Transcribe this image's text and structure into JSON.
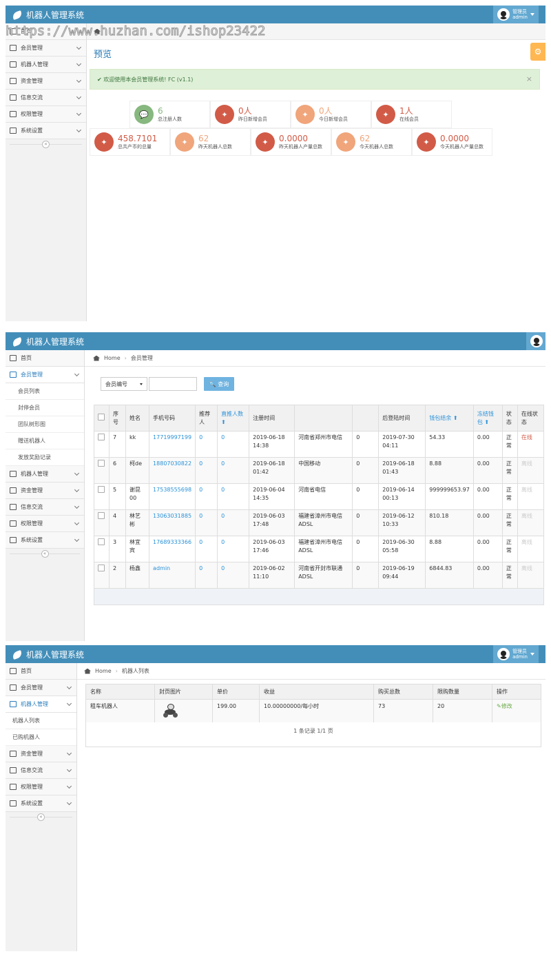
{
  "app_title": "机器人管理系统",
  "user": {
    "role": "管理员",
    "name": "admin"
  },
  "watermark": "https://www.huzhan.com/ishop23422",
  "sidebar1": [
    {
      "label": "首页"
    },
    {
      "label": "会员管理"
    },
    {
      "label": "机器人管理"
    },
    {
      "label": "资金管理"
    },
    {
      "label": "信息交流"
    },
    {
      "label": "权限管理"
    },
    {
      "label": "系统设置"
    }
  ],
  "collapse_symbol": "«",
  "dashboard": {
    "title": "预览",
    "alert": "✔ 欢迎使用本会员管理系统! FC (v1.1)",
    "close": "×",
    "gear": "⚙",
    "stats_row1": [
      {
        "value": "6",
        "label": "总注册人数",
        "color": "#87b87f"
      },
      {
        "value": "0人",
        "label": "昨日新增会员",
        "color": "#d15b47"
      },
      {
        "value": "0人",
        "label": "今日新增会员",
        "color": "#f0a57b"
      },
      {
        "value": "1人",
        "label": "在线会员",
        "color": "#d15b47"
      }
    ],
    "stats_row2": [
      {
        "value": "458.7101",
        "label": "总共产币的总量",
        "color": "#d15b47"
      },
      {
        "value": "62",
        "label": "昨天机器人总数",
        "color": "#f0a57b"
      },
      {
        "value": "0.0000",
        "label": "昨天机器人产量总数",
        "color": "#d15b47"
      },
      {
        "value": "62",
        "label": "今天机器人总数",
        "color": "#f0a57b"
      },
      {
        "value": "0.0000",
        "label": "今天机器人产量总数",
        "color": "#d15b47"
      }
    ]
  },
  "members_page": {
    "breadcrumb": {
      "home": "Home",
      "current": "会员管理"
    },
    "sidebar": {
      "home": "首页",
      "member_mgmt": "会员管理",
      "sub": [
        "会员列表",
        "封停会员",
        "团队树形图",
        "赠送机器人",
        "发放奖励记录"
      ],
      "rest": [
        "机器人管理",
        "资金管理",
        "信息交流",
        "权限管理",
        "系统设置"
      ]
    },
    "search": {
      "select": "会员编号",
      "button": "查询"
    },
    "headers": [
      "序号",
      "姓名",
      "手机号码",
      "推荐人",
      "直推人数",
      "注册时间",
      "",
      "",
      "后登陆时间",
      "钱包结余",
      "冻结钱包",
      "状态",
      "在线状态"
    ],
    "rows": [
      {
        "id": "7",
        "name": "kk",
        "phone": "17719997199",
        "ref": "0",
        "direct": "0",
        "reg": "2019-06-18 14:38",
        "loc": "河南省郑州市电信",
        "n": "0",
        "last": "2019-07-30 04:11",
        "wallet": "54.33",
        "frozen": "0.00",
        "status": "正常",
        "online": "在线",
        "on": true
      },
      {
        "id": "6",
        "name": "柯de",
        "phone": "18807030822",
        "ref": "0",
        "direct": "0",
        "reg": "2019-06-18 01:42",
        "loc": "中国移动",
        "n": "0",
        "last": "2019-06-18 01:43",
        "wallet": "8.88",
        "frozen": "0.00",
        "status": "正常",
        "online": "离线",
        "on": false
      },
      {
        "id": "5",
        "name": "谢昆00",
        "phone": "17538555698",
        "ref": "0",
        "direct": "0",
        "reg": "2019-06-04 14:35",
        "loc": "河南省电信",
        "n": "0",
        "last": "2019-06-14 00:13",
        "wallet": "999999653.97",
        "frozen": "0.00",
        "status": "正常",
        "online": "离线",
        "on": false
      },
      {
        "id": "4",
        "name": "林艺彬",
        "phone": "13063031885",
        "ref": "0",
        "direct": "0",
        "reg": "2019-06-03 17:48",
        "loc": "福建省漳州市电信ADSL",
        "n": "0",
        "last": "2019-06-12 10:33",
        "wallet": "810.18",
        "frozen": "0.00",
        "status": "正常",
        "online": "离线",
        "on": false
      },
      {
        "id": "3",
        "name": "林宜宾",
        "phone": "17689333366",
        "ref": "0",
        "direct": "0",
        "reg": "2019-06-03 17:46",
        "loc": "福建省漳州市电信ADSL",
        "n": "0",
        "last": "2019-06-30 05:58",
        "wallet": "8.88",
        "frozen": "0.00",
        "status": "正常",
        "online": "离线",
        "on": false
      },
      {
        "id": "2",
        "name": "杨鑫",
        "phone": "admin",
        "ref": "0",
        "direct": "0",
        "reg": "2019-06-02 11:10",
        "loc": "河南省开封市联通ADSL",
        "n": "0",
        "last": "2019-06-19 09:44",
        "wallet": "6844.83",
        "frozen": "0.00",
        "status": "正常",
        "online": "离线",
        "on": false
      }
    ]
  },
  "robots_page": {
    "breadcrumb": {
      "home": "Home",
      "current": "机器人列表"
    },
    "sidebar": {
      "home": "首页",
      "member_mgmt": "会员管理",
      "robot_mgmt": "机器人管理",
      "sub": [
        "机器人列表",
        "已购机器人"
      ],
      "rest": [
        "资金管理",
        "信息交流",
        "权限管理",
        "系统设置"
      ]
    },
    "headers": [
      "名称",
      "封页图片",
      "单价",
      "收益",
      "购买总数",
      "限购数量",
      "操作"
    ],
    "row": {
      "name": "租车机器人",
      "price": "199.00",
      "income": "10.00000000/每小时",
      "total": "73",
      "limit": "20",
      "action": "✎修改"
    },
    "pager": "1 条记录 1/1 页"
  }
}
